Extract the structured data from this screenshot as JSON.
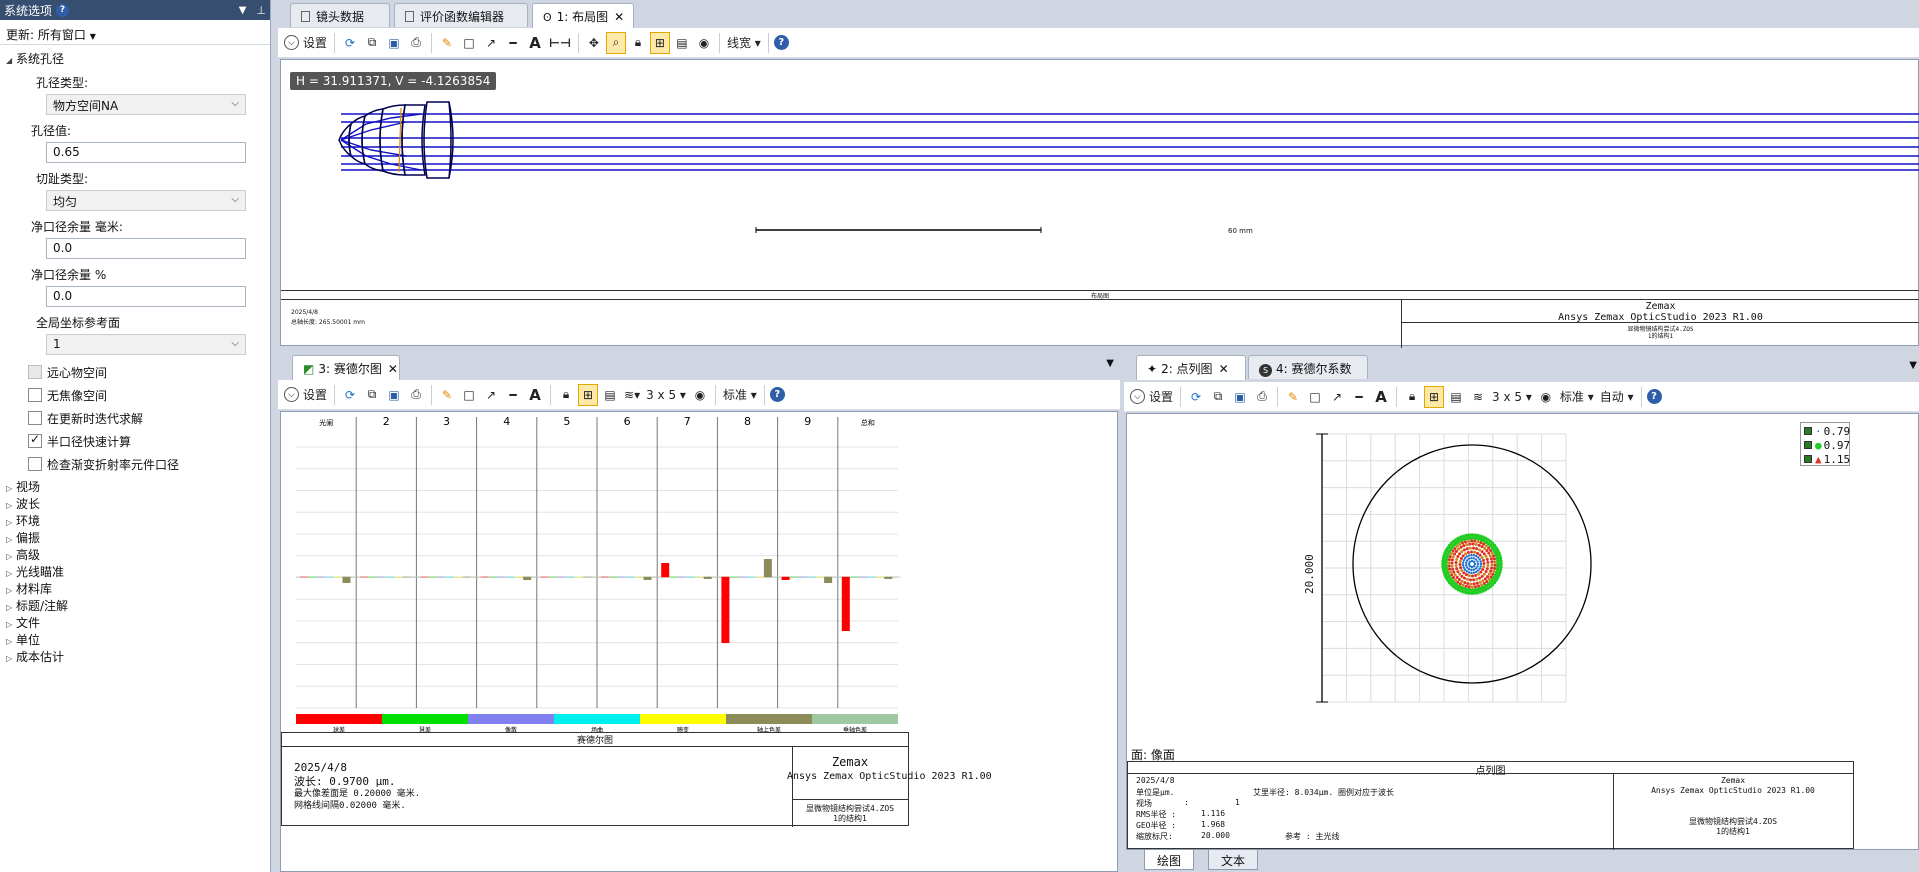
{
  "left_panel": {
    "title": "系统选项",
    "pin_glyph": "⊥",
    "update_label": "更新: 所有窗口",
    "section_aperture": "系统孔径",
    "aperture_type_label": "孔径类型:",
    "aperture_type_value": "物方空间NA",
    "aperture_value_label": "孔径值:",
    "aperture_value": "0.65",
    "apodization_label": "切趾类型:",
    "apodization_value": "均匀",
    "clear_margin_mm_label": "净口径余量 毫米:",
    "clear_margin_mm_value": "0.0",
    "clear_margin_pct_label": "净口径余量 %",
    "clear_margin_pct_value": "0.0",
    "global_ref_label": "全局坐标参考面",
    "global_ref_value": "1",
    "checkboxes": [
      {
        "label": "远心物空间",
        "checked": false,
        "disabled": true
      },
      {
        "label": "无焦像空间",
        "checked": false,
        "disabled": false
      },
      {
        "label": "在更新时迭代求解",
        "checked": false,
        "disabled": false
      },
      {
        "label": "半口径快速计算",
        "checked": true,
        "disabled": false
      },
      {
        "label": "检查渐变折射率元件口径",
        "checked": false,
        "disabled": false
      }
    ],
    "tree": [
      "视场",
      "波长",
      "环境",
      "偏振",
      "高级",
      "光线瞄准",
      "材料库",
      "标题/注解",
      "文件",
      "单位",
      "成本估计"
    ]
  },
  "top_window": {
    "tabs": [
      "镜头数据",
      "评价函数编辑器",
      "1: 布局图"
    ],
    "toolbar": {
      "settings": "设置",
      "linewidth": "线宽"
    },
    "coord_readout": "H = 31.911371, V = -4.1263854",
    "scale_label": "60 mm",
    "footer": {
      "caption": "布局图",
      "date": "2025/4/8",
      "total_length": "总轴长度:  265.50001 mm",
      "brand": "Zemax",
      "product": "Ansys Zemax OpticStudio 2023 R1.00",
      "file": "显微物镜结构尝试4.ZOS",
      "config": "1的结构1"
    }
  },
  "seidel_window": {
    "tab": "3: 赛德尔图",
    "toolbar": {
      "settings": "设置",
      "grid": "3 x 5",
      "standard": "标准"
    },
    "columns": [
      "光阑",
      "2",
      "3",
      "4",
      "5",
      "6",
      "7",
      "8",
      "9",
      "总和"
    ],
    "legend": [
      {
        "label": "球差",
        "color": "#ff0000"
      },
      {
        "label": "慧差",
        "color": "#00e000"
      },
      {
        "label": "像散",
        "color": "#8080f0"
      },
      {
        "label": "场曲",
        "color": "#00f0f0"
      },
      {
        "label": "畸变",
        "color": "#ffff00"
      },
      {
        "label": "轴上色差",
        "color": "#8c8c5a"
      },
      {
        "label": "垂轴色差",
        "color": "#a0c8a0"
      }
    ],
    "footer": {
      "caption": "赛德尔图",
      "date": "2025/4/8",
      "wavelength": "波长: 0.9700 µm.",
      "max_scale": "最大像差面是 0.20000 毫米.",
      "grid_spacing": "网格线间隔0.02000 毫米.",
      "brand": "Zemax",
      "product": "Ansys Zemax OpticStudio 2023 R1.00",
      "file": "显微物镜结构尝试4.ZOS",
      "config": "1的结构1"
    }
  },
  "spot_window": {
    "tabs": [
      "2: 点列图",
      "4: 赛德尔系数"
    ],
    "toolbar": {
      "settings": "设置",
      "grid": "3 x 5",
      "standard": "标准",
      "auto": "自动"
    },
    "legend": [
      {
        "label": "0.79",
        "color": "#1a6fd0"
      },
      {
        "label": "0.97",
        "color": "#22cc22"
      },
      {
        "label": "1.15",
        "color": "#e03020"
      }
    ],
    "scale_label": "20.000",
    "surface_label": "面: 像面",
    "footer": {
      "caption": "点列图",
      "date": "2025/4/8",
      "unit": "单位是µm.",
      "airy": "艾里半径: 8.034µm. 圈例对应于波长",
      "field_label": "视场",
      "field_colon": ":",
      "field_value": "1",
      "rms_label": "RMS半径 :",
      "rms_value": "1.116",
      "geo_label": "GEO半径 :",
      "geo_value": "1.968",
      "scale_label": "缩放标尺:",
      "scale_value": "20.000",
      "ref_label": "参考  : 主光线",
      "brand": "Zemax",
      "product": "Ansys Zemax OpticStudio 2023 R1.00",
      "file": "显微物镜结构尝试4.ZOS",
      "config": "1的结构1"
    },
    "bottom_tabs": [
      "绘图",
      "文本"
    ]
  },
  "colors": {
    "ray": "#1010c8",
    "lens": "#000080",
    "accent": "#364e6f"
  }
}
